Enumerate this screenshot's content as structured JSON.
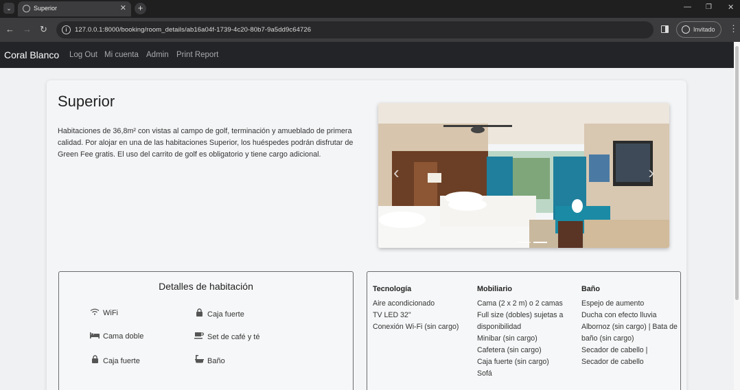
{
  "browser": {
    "tab_title": "Superior",
    "url": "127.0.0.1:8000/booking/room_details/ab16a04f-1739-4c20-80b7-9a5dd9c64726",
    "profile_label": "Invitado"
  },
  "navbar": {
    "brand": "Coral Blanco",
    "links": [
      "Log Out",
      "Mi cuenta",
      "Admin",
      "Print Report"
    ]
  },
  "room": {
    "title": "Superior",
    "description": "Habitaciones de 36,8m² con vistas al campo de golf, terminación y amueblado de primera calidad. Por alojar en una de las habitaciones Superior, los huéspedes podrán disfrutar de Green Fee gratis. El uso del carrito de golf es obligatorio y tiene cargo adicional."
  },
  "carousel": {
    "indicator_count": 2,
    "active_index": 1
  },
  "details": {
    "title": "Detalles de habitación",
    "amenities": [
      {
        "label": "WiFi",
        "icon": "wifi-icon"
      },
      {
        "label": "Caja fuerte",
        "icon": "lock-icon"
      },
      {
        "label": "Cama doble",
        "icon": "bed-icon"
      },
      {
        "label": "Set de café y té",
        "icon": "coffee-icon"
      },
      {
        "label": "Caja fuerte",
        "icon": "lock-icon"
      },
      {
        "label": "Baño",
        "icon": "bathtub-icon"
      }
    ]
  },
  "equipment": {
    "tecnologia": {
      "title": "Tecnología",
      "items": [
        "Aire acondicionado",
        "TV LED 32\"",
        "Conexión Wi-Fi (sin cargo)"
      ]
    },
    "mobiliario": {
      "title": "Mobiliario",
      "items": [
        "Cama (2 x 2 m) o 2 camas",
        "Full size (dobles) sujetas a disponibilidad",
        "Minibar (sin cargo)",
        "Cafetera (sin cargo)",
        "Caja fuerte (sin cargo)",
        "Sofá"
      ]
    },
    "bano": {
      "title": "Baño",
      "items": [
        "Espejo de aumento",
        "Ducha con efecto lluvia",
        "Albornoz (sin cargo) | Bata de baño (sin cargo)",
        "Secador de cabello |",
        "Secador de cabello"
      ]
    }
  }
}
